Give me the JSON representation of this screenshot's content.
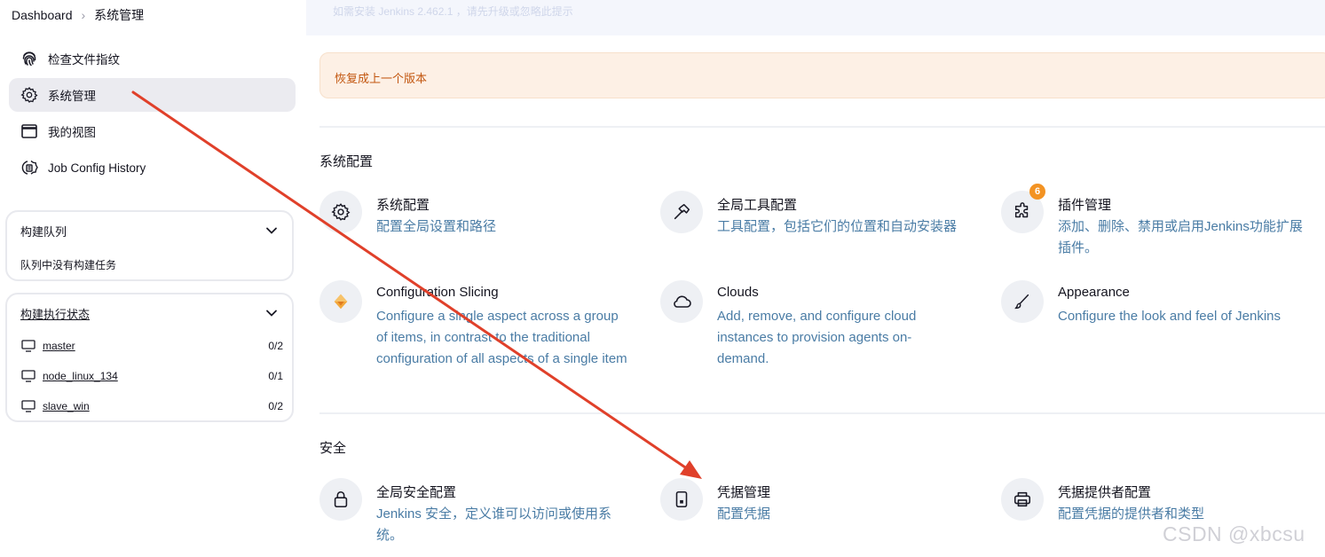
{
  "breadcrumb": {
    "root": "Dashboard",
    "current": "系统管理"
  },
  "top_banner_faded": "如需安装 Jenkins 2.462.1 ，请先升级或忽略此提示",
  "sidebar": {
    "items": [
      {
        "label": "检查文件指纹",
        "icon": "fingerprint-icon"
      },
      {
        "label": "系统管理",
        "icon": "gear-icon"
      },
      {
        "label": "我的视图",
        "icon": "window-icon"
      },
      {
        "label": "Job Config History",
        "icon": "history-icon"
      }
    ]
  },
  "build_queue": {
    "title": "构建队列",
    "empty": "队列中没有构建任务"
  },
  "executors": {
    "title": "构建执行状态",
    "nodes": [
      {
        "name": "master",
        "count": "0/2"
      },
      {
        "name": "node_linux_134",
        "count": "0/1"
      },
      {
        "name": "slave_win",
        "count": "0/2"
      }
    ]
  },
  "notice": "恢复成上一个版本",
  "sections": [
    {
      "title": "系统配置",
      "tiles": [
        {
          "title": "系统配置",
          "desc": "配置全局设置和路径",
          "icon": "gear-icon"
        },
        {
          "title": "全局工具配置",
          "desc": "工具配置，包括它们的位置和自动安装器",
          "icon": "hammer-icon"
        },
        {
          "title": "插件管理",
          "desc": "添加、删除、禁用或启用Jenkins功能扩展插件。",
          "icon": "puzzle-icon",
          "badge": "6"
        },
        {
          "title": "Configuration Slicing",
          "desc": "Configure a single aspect across a group of items, in contrast to the traditional configuration of all aspects of a single item",
          "icon": "slicing-icon"
        },
        {
          "title": "Clouds",
          "desc": "Add, remove, and configure cloud instances to provision agents on-demand.",
          "icon": "cloud-icon"
        },
        {
          "title": "Appearance",
          "desc": "Configure the look and feel of Jenkins",
          "icon": "brush-icon"
        }
      ]
    },
    {
      "title": "安全",
      "tiles": [
        {
          "title": "全局安全配置",
          "desc": "Jenkins 安全，定义谁可以访问或使用系统。",
          "icon": "lock-icon"
        },
        {
          "title": "凭据管理",
          "desc": "配置凭据",
          "icon": "phone-id-icon"
        },
        {
          "title": "凭据提供者配置",
          "desc": "配置凭据的提供者和类型",
          "icon": "printer-icon"
        }
      ]
    }
  ],
  "watermark": "CSDN @xbcsu",
  "colors": {
    "accent": "#4a7ca5",
    "notice_text": "#c2560f",
    "notice_bg": "#fdf0e5",
    "badge": "#f39323",
    "arrow": "#e0402a"
  }
}
